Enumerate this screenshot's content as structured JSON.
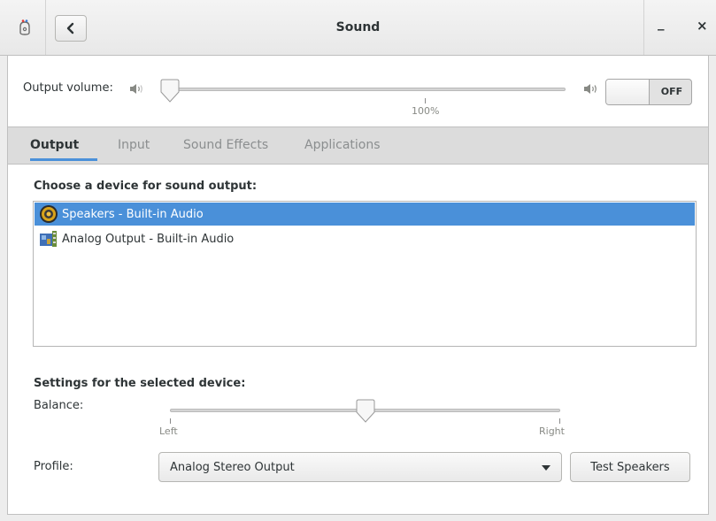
{
  "window": {
    "title": "Sound",
    "minimize_label": "_",
    "close_label": "×"
  },
  "output_volume": {
    "label": "Output volume:",
    "level_percent": 0,
    "mark_label": "100%",
    "toggle_label": "OFF",
    "toggle_state": "off"
  },
  "tabs": [
    {
      "label": "Output",
      "active": true
    },
    {
      "label": "Input",
      "active": false
    },
    {
      "label": "Sound Effects",
      "active": false
    },
    {
      "label": "Applications",
      "active": false
    }
  ],
  "output": {
    "choose_heading": "Choose a device for sound output:",
    "devices": [
      {
        "label": "Speakers - Built-in Audio",
        "icon": "speaker-icon",
        "selected": true
      },
      {
        "label": "Analog Output - Built-in Audio",
        "icon": "audio-card-icon",
        "selected": false
      }
    ],
    "settings_heading": "Settings for the selected device:",
    "balance": {
      "label": "Balance:",
      "left_label": "Left",
      "right_label": "Right",
      "value": 0.5
    },
    "profile": {
      "label": "Profile:",
      "selected": "Analog Stereo Output"
    },
    "test_button": "Test Speakers"
  },
  "colors": {
    "accent": "#4a90d9",
    "window_bg": "#ededed"
  }
}
